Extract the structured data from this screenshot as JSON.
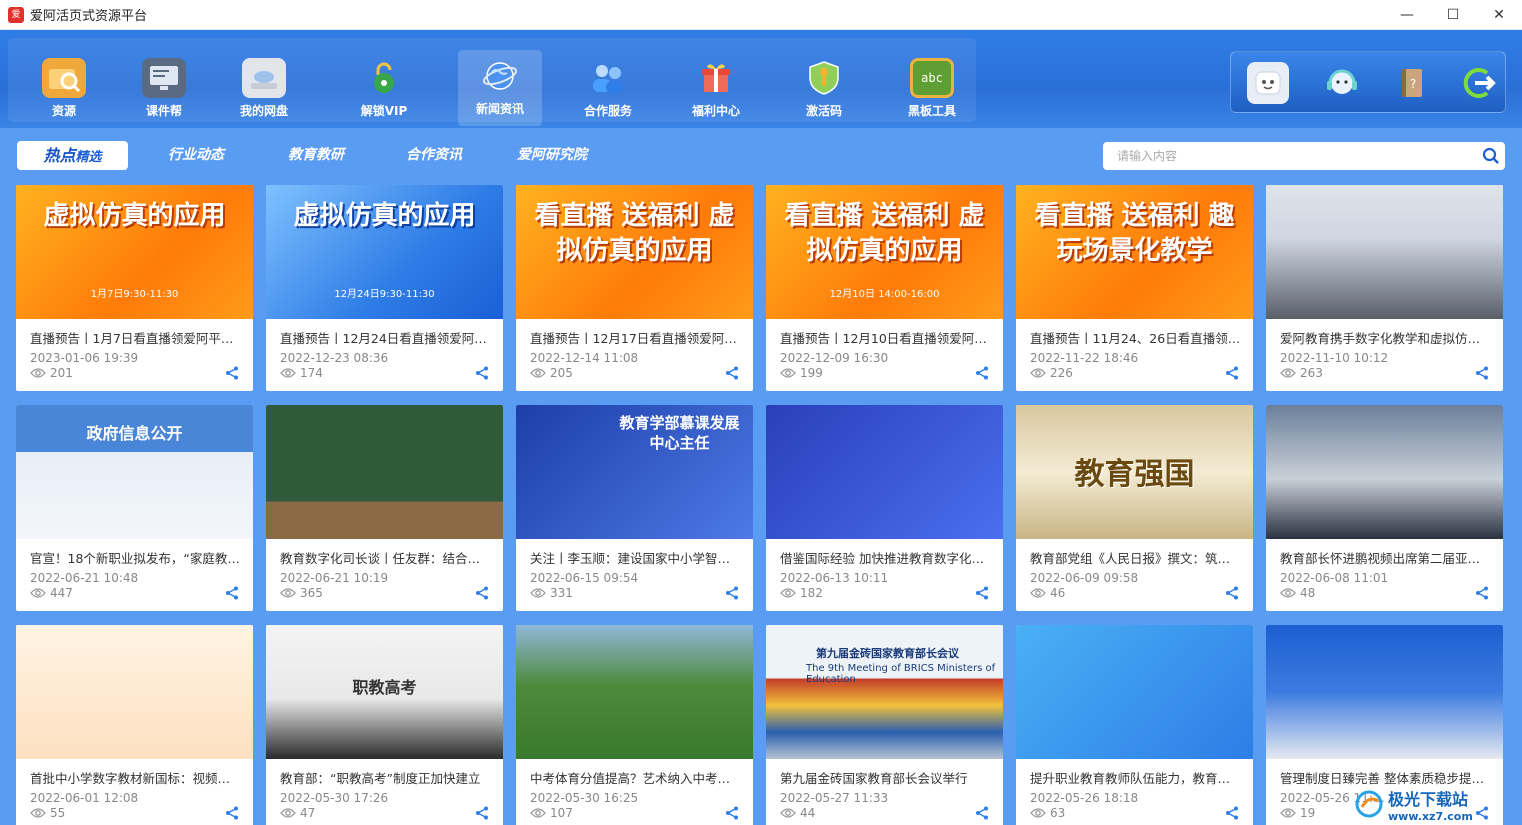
{
  "window": {
    "title": "爱阿活页式资源平台",
    "logo_text": "爱",
    "minimize": "—",
    "maximize": "☐",
    "close": "✕"
  },
  "toolbar": {
    "items": [
      {
        "label": "资源",
        "icon": "folder-search-icon",
        "color": "#f0a83a"
      },
      {
        "label": "课件帮",
        "icon": "monitor-icon",
        "color": "#5a6a80"
      },
      {
        "label": "我的网盘",
        "icon": "cloud-drive-icon",
        "color": "#e2e6ea"
      },
      {
        "label": "解锁VIP",
        "icon": "unlock-icon",
        "color": "#3aa64a"
      },
      {
        "label": "新闻资讯",
        "icon": "globe-icon",
        "color": "#2c74d6"
      },
      {
        "label": "合作服务",
        "icon": "people-icon",
        "color": "#3a8ee6"
      },
      {
        "label": "福利中心",
        "icon": "gift-icon",
        "color": "#e85a4a"
      },
      {
        "label": "激活码",
        "icon": "shield-icon",
        "color": "#f0b432"
      },
      {
        "label": "黑板工具",
        "icon": "blackboard-icon",
        "color": "#6aa83a"
      }
    ],
    "blackboard_text": "abc",
    "right_tools": [
      {
        "icon": "face-icon"
      },
      {
        "icon": "headset-icon"
      },
      {
        "icon": "notebook-icon"
      },
      {
        "icon": "logout-icon"
      }
    ]
  },
  "tabs": {
    "items": [
      {
        "label": "行业动态"
      },
      {
        "label": "教育教研"
      },
      {
        "label": "合作资讯"
      },
      {
        "label": "爱阿研究院"
      }
    ],
    "active_hot": "热点",
    "active_rest": "精选"
  },
  "search": {
    "placeholder": "请输入内容",
    "value": ""
  },
  "cards": [
    {
      "title": "直播预告丨1月7日看直播领爱阿平…",
      "date": "2023-01-06 19:39",
      "views": "201",
      "thumb": "orange",
      "thumb_text": "虚拟仿真的应用",
      "thumb_sub": "1月7日9:30-11:30"
    },
    {
      "title": "直播预告丨12月24日看直播领爱阿…",
      "date": "2022-12-23 08:36",
      "views": "174",
      "thumb": "blue",
      "thumb_text": "虚拟仿真的应用",
      "thumb_sub": "12月24日9:30-11:30"
    },
    {
      "title": "直播预告丨12月17日看直播领爱阿…",
      "date": "2022-12-14 11:08",
      "views": "205",
      "thumb": "orange",
      "thumb_text": "看直播 送福利 虚拟仿真的应用",
      "thumb_sub": ""
    },
    {
      "title": "直播预告丨12月10日看直播领爱阿…",
      "date": "2022-12-09 16:30",
      "views": "199",
      "thumb": "orange",
      "thumb_text": "看直播 送福利 虚拟仿真的应用",
      "thumb_sub": "12月10日 14:00-16:00"
    },
    {
      "title": "直播预告丨11月24、26日看直播领…",
      "date": "2022-11-22 18:46",
      "views": "226",
      "thumb": "orange",
      "thumb_text": "看直播 送福利 趣玩场景化教学",
      "thumb_sub": ""
    },
    {
      "title": "爱阿教育携手数字化教学和虚拟仿…",
      "date": "2022-11-10 10:12",
      "views": "263",
      "thumb": "photo-group",
      "thumb_text": "",
      "thumb_sub": ""
    },
    {
      "title": "官宣！18个新职业拟发布，“家庭教…",
      "date": "2022-06-21 10:48",
      "views": "447",
      "thumb": "gov",
      "thumb_text": "政府信息公开",
      "thumb_sub": ""
    },
    {
      "title": "教育数字化司长谈丨任友群：结合…",
      "date": "2022-06-21 10:19",
      "views": "365",
      "thumb": "chalkboard",
      "thumb_text": "",
      "thumb_sub": ""
    },
    {
      "title": "关注丨李玉顺：建设国家中小学智…",
      "date": "2022-06-15 09:54",
      "views": "331",
      "thumb": "speaker",
      "thumb_text": "教育学部慕课发展中心主任",
      "thumb_sub": ""
    },
    {
      "title": "借鉴国际经验 加快推进教育数字化…",
      "date": "2022-06-13 10:11",
      "views": "182",
      "thumb": "isometric",
      "thumb_text": "",
      "thumb_sub": ""
    },
    {
      "title": "教育部党组《人民日报》撰文：筑…",
      "date": "2022-06-09 09:58",
      "views": "46",
      "thumb": "gold",
      "thumb_text": "教育强国",
      "thumb_sub": ""
    },
    {
      "title": "教育部长怀进鹏视频出席第二届亚…",
      "date": "2022-06-08 11:01",
      "views": "48",
      "thumb": "official",
      "thumb_text": "",
      "thumb_sub": ""
    },
    {
      "title": "首批中小学数字教材新国标：视频…",
      "date": "2022-06-01 12:08",
      "views": "55",
      "thumb": "cartoon",
      "thumb_text": "",
      "thumb_sub": ""
    },
    {
      "title": "教育部：“职教高考”制度正加快建立",
      "date": "2022-05-30 17:26",
      "views": "47",
      "thumb": "classroom",
      "thumb_text": "职教高考",
      "thumb_sub": ""
    },
    {
      "title": "中考体育分值提高？艺术纳入中考…",
      "date": "2022-05-30 16:25",
      "views": "107",
      "thumb": "soccer",
      "thumb_text": "",
      "thumb_sub": ""
    },
    {
      "title": "第九届金砖国家教育部长会议举行",
      "date": "2022-05-27 11:33",
      "views": "44",
      "thumb": "brics",
      "thumb_text": "第九届金砖国家教育部长会议",
      "thumb_sub": "The 9th Meeting of BRICS Ministers of Education"
    },
    {
      "title": "提升职业教育教师队伍能力，教育…",
      "date": "2022-05-26 18:18",
      "views": "63",
      "thumb": "books",
      "thumb_text": "",
      "thumb_sub": ""
    },
    {
      "title": "管理制度日臻完善 整体素质稳步提…",
      "date": "2022-05-26 11:…",
      "views": "19",
      "thumb": "official2",
      "thumb_text": "",
      "thumb_sub": ""
    }
  ],
  "watermark": {
    "text": "极光下载站",
    "url": "www.xz7.com"
  }
}
